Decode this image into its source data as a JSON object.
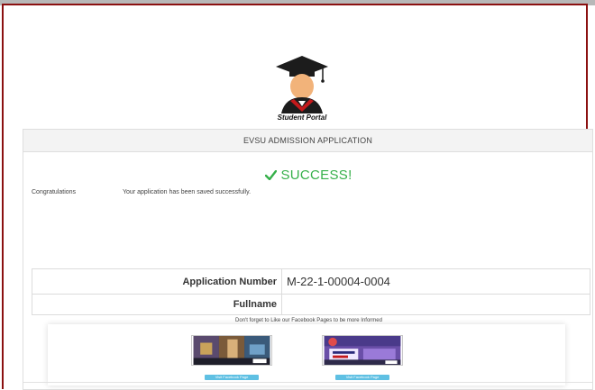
{
  "portal": {
    "logo_caption": "Student Portal"
  },
  "panel": {
    "title": "EVSU ADMISSION APPLICATION",
    "success_text": "SUCCESS!",
    "message_label": "Congratulations",
    "message_text": "Your application has been saved successfully."
  },
  "details": {
    "rows": [
      {
        "label": "Application Number",
        "value": "M-22-1-00004-0004"
      },
      {
        "label": "Fullname",
        "value": ""
      }
    ]
  },
  "facebook": {
    "note": "Don't forget to Like our Facebook Pages to be more Informed",
    "pages": [
      {
        "button_label": "Visit Facebook Page"
      },
      {
        "button_label": "Visit Facebook Page"
      }
    ]
  },
  "colors": {
    "success": "#36b04a",
    "frame_border": "#8b1010",
    "fb_button": "#5fc0e3"
  },
  "icons": {
    "success": "check-icon",
    "logo": "graduate-icon"
  }
}
